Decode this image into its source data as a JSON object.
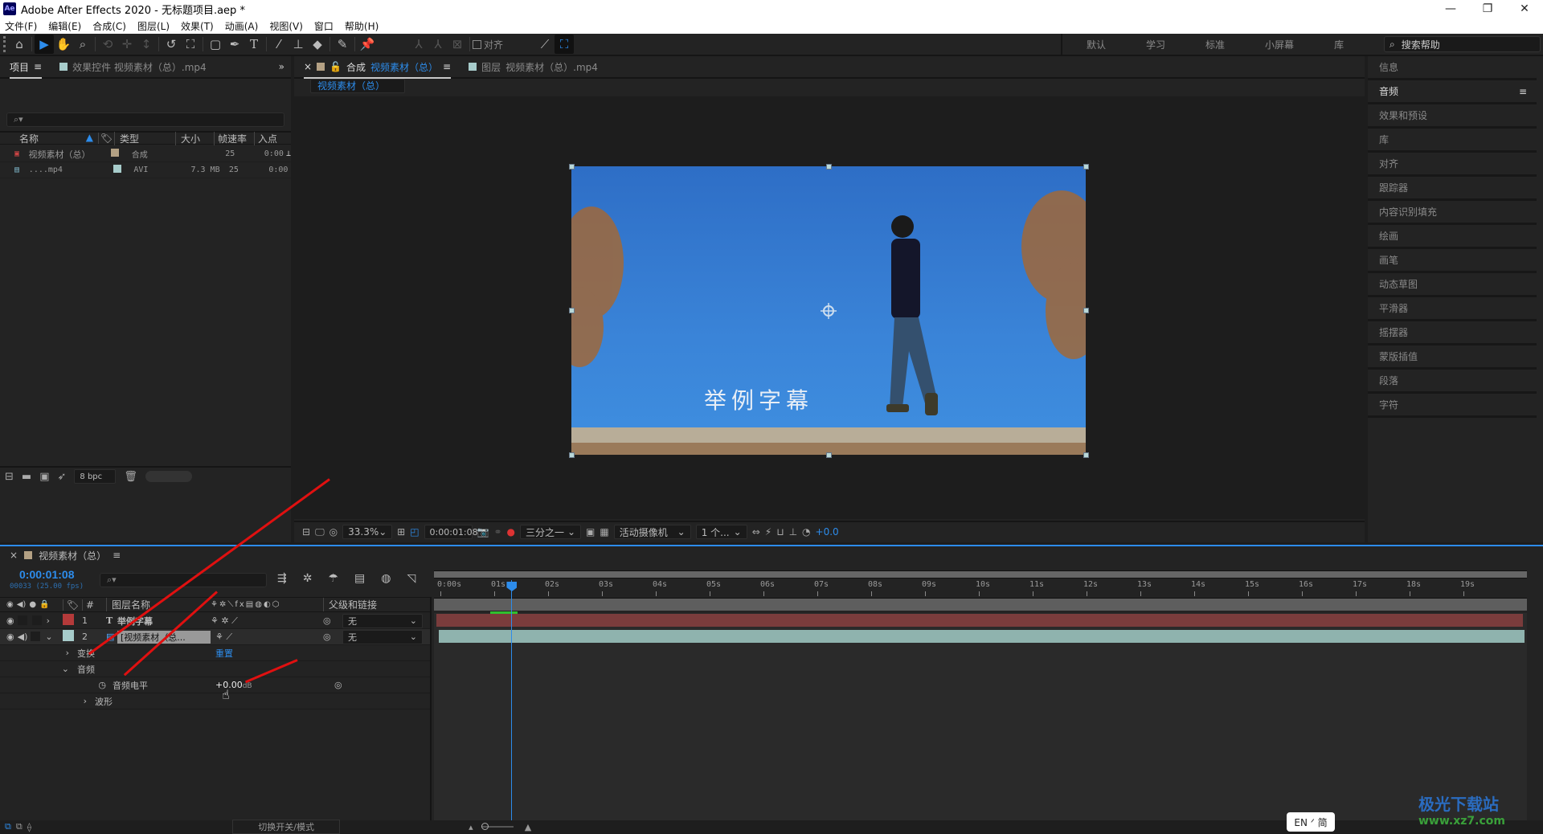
{
  "window": {
    "title": "Adobe After Effects 2020 - 无标题项目.aep *",
    "app_icon": "Ae",
    "controls": [
      "minimize-icon",
      "restore-icon",
      "close-icon"
    ]
  },
  "menu": [
    "文件(F)",
    "编辑(E)",
    "合成(C)",
    "图层(L)",
    "效果(T)",
    "动画(A)",
    "视图(V)",
    "窗口",
    "帮助(H)"
  ],
  "toolbar": {
    "tools": [
      "home-icon",
      "selection-tool-icon",
      "hand-tool-icon",
      "zoom-tool-icon",
      "orbit-camera-icon",
      "pan-camera-icon",
      "dolly-camera-icon",
      "rotation-tool-icon",
      "pan-behind-icon",
      "rectangle-tool-icon",
      "pen-tool-icon",
      "type-tool-icon",
      "brush-tool-icon",
      "clone-stamp-icon",
      "eraser-icon",
      "roto-brush-icon",
      "puppet-pin-icon"
    ],
    "snap_label": "对齐",
    "workspaces": [
      "默认",
      "学习",
      "标准",
      "小屏幕",
      "库"
    ],
    "help_search_placeholder": "搜索帮助"
  },
  "project_panel": {
    "tabs": [
      {
        "label": "项目",
        "active": true
      },
      {
        "label": "效果控件 视频素材（总）.mp4",
        "active": false
      }
    ],
    "search_placeholder": "",
    "columns": [
      "名称",
      "类型",
      "大小",
      "帧速率",
      "入点"
    ],
    "items": [
      {
        "name": "视频素材（总）",
        "label_color": "#b4a184",
        "type": "合成",
        "size": "",
        "fps": "25",
        "in": "0:00",
        "icon": "composition-icon"
      },
      {
        "name": "....mp4",
        "label_color": "#a7cccb",
        "type": "AVI",
        "size": "7.3 MB",
        "fps": "25",
        "in": "0:00",
        "icon": "footage-icon"
      }
    ],
    "bpc": "8 bpc"
  },
  "comp_panel": {
    "tabs": [
      {
        "prefix": "合成",
        "name": "视频素材（总）",
        "active": true
      },
      {
        "prefix": "图层",
        "name": "视频素材（总）.mp4",
        "active": false
      }
    ],
    "breadcrumb": "视频素材（总）",
    "caption_text": "举例字幕",
    "footer": {
      "zoom": "33.3%",
      "timecode": "0:00:01:08",
      "resolution": "三分之一",
      "camera": "活动摄像机",
      "views": "1 个...",
      "exposure": "+0.0"
    }
  },
  "right_panel": {
    "items": [
      {
        "label": "信息",
        "active": false
      },
      {
        "label": "音频",
        "active": true
      },
      {
        "label": "效果和预设",
        "active": false
      },
      {
        "label": "库",
        "active": false
      },
      {
        "label": "对齐",
        "active": false
      },
      {
        "label": "跟踪器",
        "active": false
      },
      {
        "label": "内容识别填充",
        "active": false
      },
      {
        "label": "绘画",
        "active": false
      },
      {
        "label": "画笔",
        "active": false
      },
      {
        "label": "动态草图",
        "active": false
      },
      {
        "label": "平滑器",
        "active": false
      },
      {
        "label": "摇摆器",
        "active": false
      },
      {
        "label": "蒙版插值",
        "active": false
      },
      {
        "label": "段落",
        "active": false
      },
      {
        "label": "字符",
        "active": false
      }
    ]
  },
  "timeline": {
    "comp_name": "视频素材（总）",
    "timecode": "0:00:01:08",
    "frame_info": "00033 (25.00 fps)",
    "columns": {
      "layer_name": "图层名称",
      "parent": "父级和链接",
      "hash": "#"
    },
    "layers": [
      {
        "num": "1",
        "type_icon": "T",
        "name": "举例字幕",
        "color": "#b43a3a",
        "parent": "无",
        "bar_color": "#7a3c3c"
      },
      {
        "num": "2",
        "type_icon": "footage",
        "name": "[视频素材（总...",
        "color": "#a7cccb",
        "parent": "无",
        "bar_color": "#8fb3ae"
      }
    ],
    "properties": [
      {
        "label": "变换",
        "value": "重置",
        "indent": 1,
        "expanded": false
      },
      {
        "label": "音频",
        "value": "",
        "indent": 1,
        "expanded": true
      },
      {
        "label": "音频电平",
        "value": "+0.00",
        "unit": "dB",
        "indent": 2
      },
      {
        "label": "波形",
        "value": "",
        "indent": 2,
        "expanded": false
      }
    ],
    "ruler_ticks": [
      "0:00s",
      "01s",
      "02s",
      "03s",
      "04s",
      "05s",
      "06s",
      "07s",
      "08s",
      "09s",
      "10s",
      "11s",
      "12s",
      "13s",
      "14s",
      "15s",
      "16s",
      "17s",
      "18s",
      "19s"
    ],
    "playhead_seconds": 1.32,
    "duration_seconds": 20,
    "footer_toggle": "切换开关/模式"
  },
  "ime": "EN ᐟ 简",
  "watermark": {
    "name": "极光下载站",
    "url": "www.xz7.com"
  }
}
